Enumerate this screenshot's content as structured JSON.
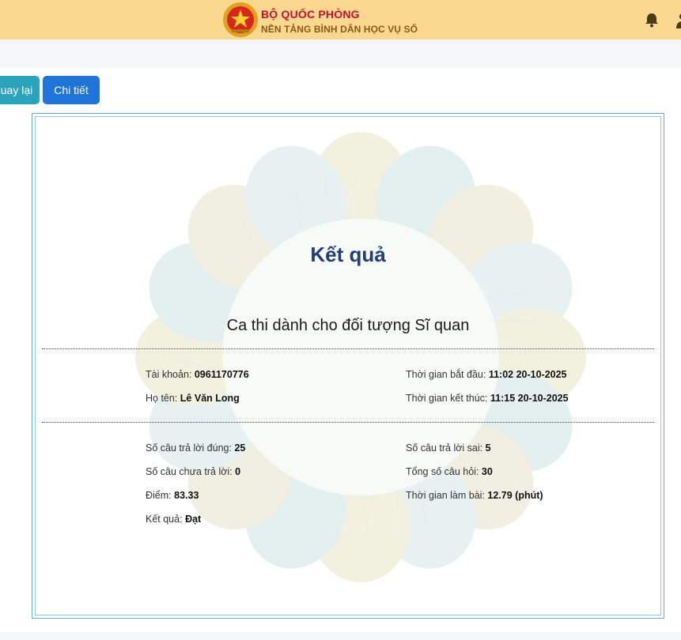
{
  "header": {
    "title": "BỘ QUỐC PHÒNG",
    "subtitle": "NỀN TẢNG BÌNH DÂN HỌC VỤ SỐ",
    "icons": [
      "emblem-icon",
      "bell-icon",
      "user-icon"
    ]
  },
  "buttons": {
    "back": "uay lại",
    "detail": "Chi tiết"
  },
  "result": {
    "heading": "Kết quả",
    "exam_title": "Ca thi dành cho đối tượng Sĩ quan",
    "account_label": "Tài khoản:",
    "account_value": "0961170776",
    "name_label": "Họ tên:",
    "name_value": "Lê Văn Long",
    "start_label": "Thời gian bắt đầu:",
    "start_value": "11:02 20-10-2025",
    "end_label": "Thời gian kết thúc:",
    "end_value": "11:15 20-10-2025",
    "correct_label": "Số câu trả lời đúng:",
    "correct_value": "25",
    "wrong_label": "Số câu trả lời sai:",
    "wrong_value": "5",
    "unanswered_label": "Số câu chưa trả lời:",
    "unanswered_value": "0",
    "total_label": "Tổng số câu hỏi:",
    "total_value": "30",
    "score_label": "Điểm:",
    "score_value": "83.33",
    "duration_label": "Thời gian làm bài:",
    "duration_value": "12.79 (phút)",
    "outcome_label": "Kết quả:",
    "outcome_value": "Đạt"
  },
  "colors": {
    "header_bg": "#fbd88f",
    "brand_red": "#c8102e",
    "button_back": "#2aa3bd",
    "button_detail": "#1e74d8",
    "heading_blue": "#1f3e7a"
  }
}
